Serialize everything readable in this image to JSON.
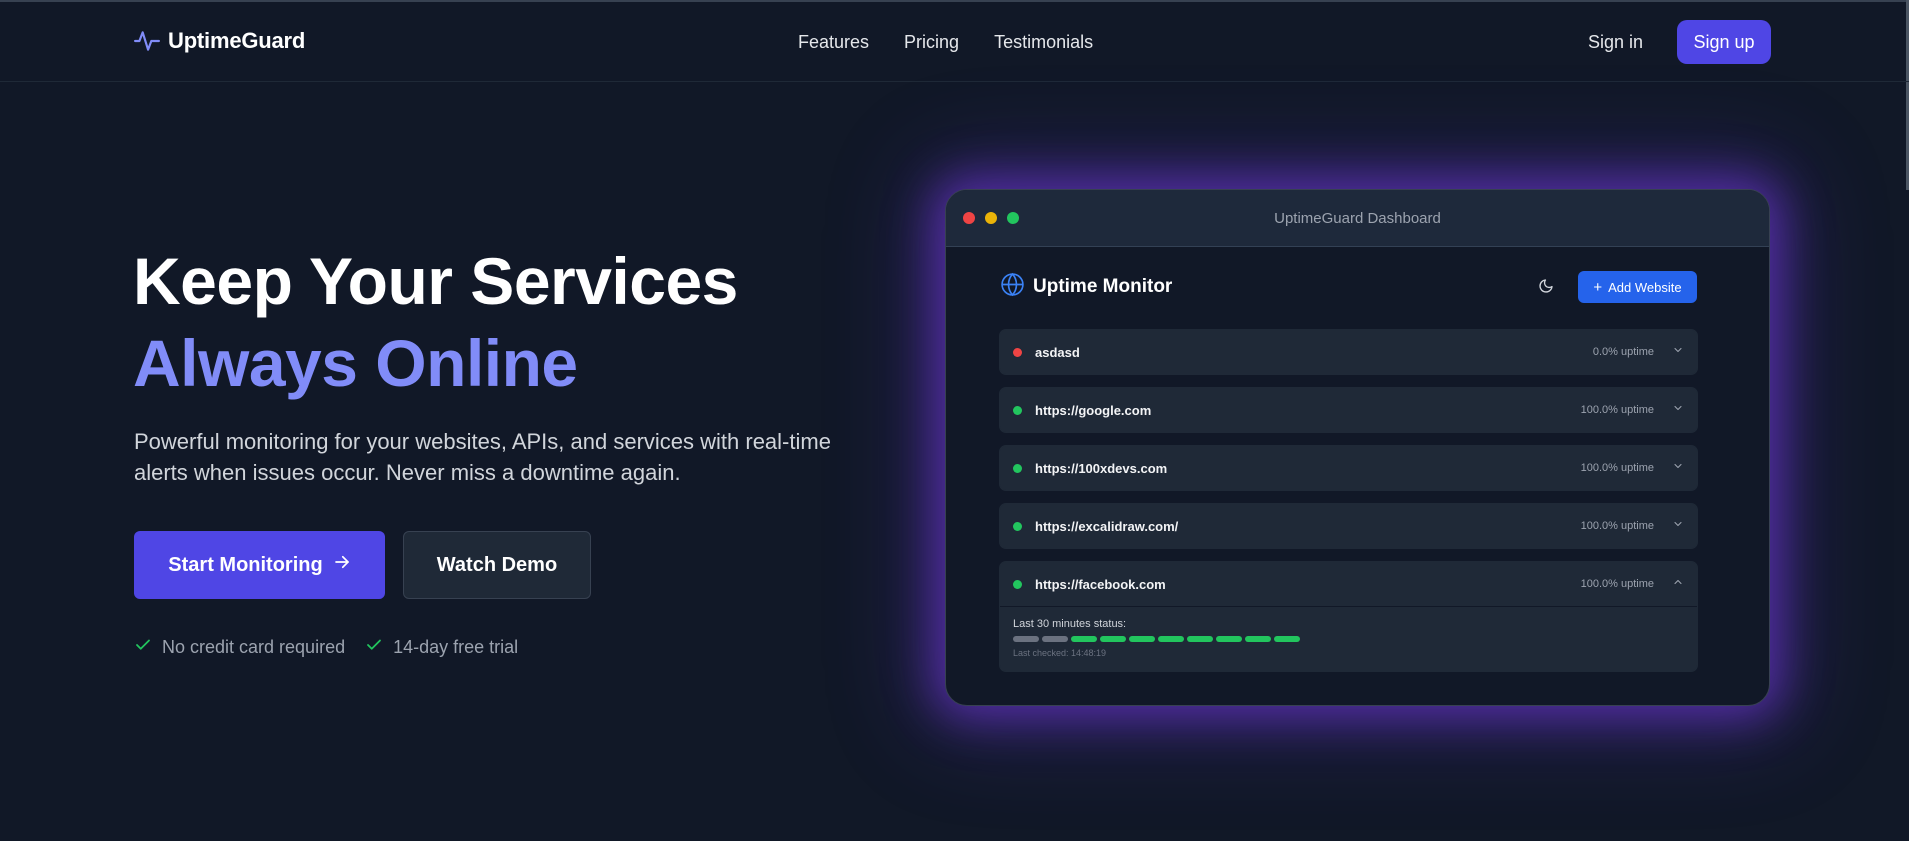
{
  "nav": {
    "brand": "UptimeGuard",
    "links": [
      "Features",
      "Pricing",
      "Testimonials"
    ],
    "signin": "Sign in",
    "signup": "Sign up"
  },
  "hero": {
    "title_line1": "Keep Your Services",
    "title_line2": "Always Online",
    "subtitle": "Powerful monitoring for your websites, APIs, and services with real-time alerts when issues occur. Never miss a downtime again.",
    "primary_cta": "Start Monitoring",
    "secondary_cta": "Watch Demo",
    "perks": [
      "No credit card required",
      "14-day free trial"
    ]
  },
  "dashboard": {
    "window_title": "UptimeGuard Dashboard",
    "app_title": "Uptime Monitor",
    "add_button": "Add Website",
    "sites": [
      {
        "url": "asdasd",
        "uptime": "0.0% uptime",
        "status": "down",
        "expanded": false
      },
      {
        "url": "https://google.com",
        "uptime": "100.0% uptime",
        "status": "up",
        "expanded": false
      },
      {
        "url": "https://100xdevs.com",
        "uptime": "100.0% uptime",
        "status": "up",
        "expanded": false
      },
      {
        "url": "https://excalidraw.com/",
        "uptime": "100.0% uptime",
        "status": "up",
        "expanded": false
      },
      {
        "url": "https://facebook.com",
        "uptime": "100.0% uptime",
        "status": "up",
        "expanded": true
      }
    ],
    "detail": {
      "label": "Last 30 minutes status:",
      "ticks": [
        "unknown",
        "unknown",
        "up",
        "up",
        "up",
        "up",
        "up",
        "up",
        "up",
        "up"
      ],
      "last_checked": "Last checked: 14:48:19"
    }
  },
  "colors": {
    "accent": "#4f46e5",
    "hero_accent": "#818cf8",
    "up": "#22c55e",
    "down": "#ef4444",
    "unknown": "#6b7280"
  }
}
